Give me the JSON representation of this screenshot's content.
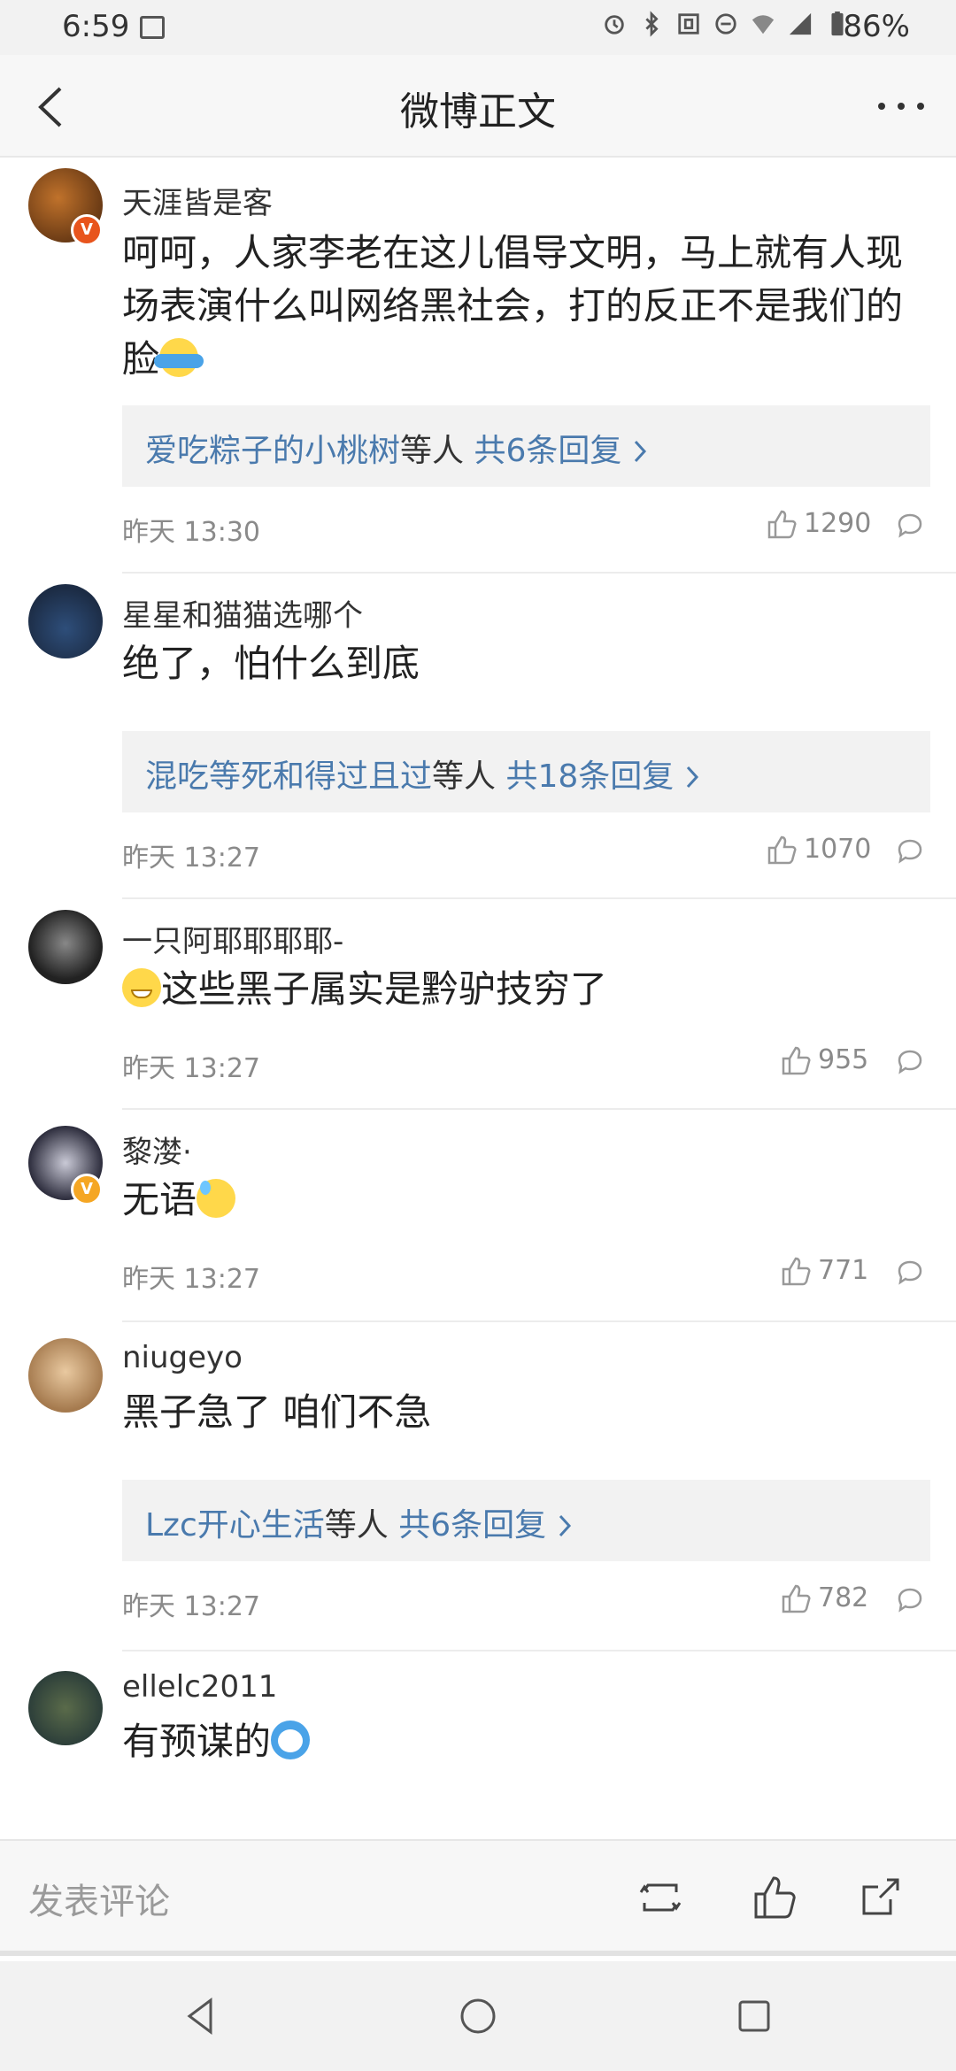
{
  "status_bar": {
    "time": "6:59",
    "battery": "86%"
  },
  "header": {
    "title": "微博正文"
  },
  "comments": [
    {
      "name": "天涯皆是客",
      "text": "呵呵，人家李老在这儿倡导文明，马上就有人现场表演什么叫网络黑社会，打的反正不是我们的脸",
      "reply_name": "爱吃粽子的小桃树",
      "reply_mid": "等人",
      "reply_count": "共6条回复",
      "time": "昨天 13:30",
      "likes": "1290",
      "verified": true,
      "emoji": "shrug-emoji"
    },
    {
      "name": "星星和猫猫选哪个",
      "text": "绝了，怕什么到底",
      "reply_name": "混吃等死和得过且过",
      "reply_mid": "等人",
      "reply_count": "共18条回复",
      "time": "昨天 13:27",
      "likes": "1070"
    },
    {
      "name": "一只阿耶耶耶耶-",
      "text": "这些黑子属实是黔驴技穷了",
      "time": "昨天 13:27",
      "likes": "955",
      "emoji": "grin-emoji"
    },
    {
      "name": "黎漤·",
      "text": "无语",
      "time": "昨天 13:27",
      "likes": "771",
      "verified": true,
      "emoji": "sweat-emoji"
    },
    {
      "name": "niugeyo",
      "text": "黑子急了 咱们不急",
      "reply_name": "Lzc开心生活",
      "reply_mid": "等人",
      "reply_count": "共6条回复",
      "time": "昨天 13:27",
      "likes": "782"
    },
    {
      "name": "ellelc2011",
      "text": "有预谋的",
      "emoji": "doge-emoji"
    }
  ],
  "action_bar": {
    "placeholder": "发表评论"
  },
  "colors": {
    "link": "#4a7aad",
    "muted": "#8a8a8a",
    "badge_red": "#e8541c",
    "badge_gold": "#f5a623"
  }
}
